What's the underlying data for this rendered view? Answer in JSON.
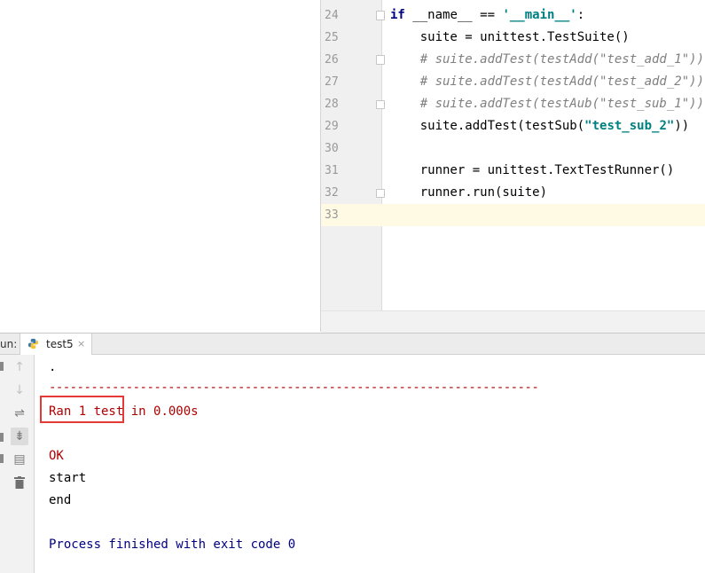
{
  "editor": {
    "lines": [
      {
        "num": "24",
        "segments": [
          {
            "t": "if ",
            "c": "kw"
          },
          {
            "t": "__name__ == ",
            "c": "fn"
          },
          {
            "t": "'__main__'",
            "c": "str"
          },
          {
            "t": ":",
            "c": "fn"
          }
        ]
      },
      {
        "num": "25",
        "segments": [
          {
            "t": "    suite = unittest.TestSuite()",
            "c": "fn"
          }
        ]
      },
      {
        "num": "26",
        "segments": [
          {
            "t": "    # suite.addTest(testAdd(\"test_add_1\"))",
            "c": "cmt"
          }
        ]
      },
      {
        "num": "27",
        "segments": [
          {
            "t": "    # suite.addTest(testAdd(\"test_add_2\"))",
            "c": "cmt"
          }
        ]
      },
      {
        "num": "28",
        "segments": [
          {
            "t": "    # suite.addTest(testAub(\"test_sub_1\"))",
            "c": "cmt"
          }
        ]
      },
      {
        "num": "29",
        "segments": [
          {
            "t": "    suite.addTest(testSub(",
            "c": "fn"
          },
          {
            "t": "\"test_sub_2\"",
            "c": "str"
          },
          {
            "t": "))",
            "c": "fn"
          }
        ]
      },
      {
        "num": "30",
        "segments": []
      },
      {
        "num": "31",
        "segments": [
          {
            "t": "    runner = unittest.TextTestRunner()",
            "c": "fn"
          }
        ]
      },
      {
        "num": "32",
        "segments": [
          {
            "t": "    runner.run(suite)",
            "c": "fn"
          }
        ]
      },
      {
        "num": "33",
        "segments": []
      }
    ],
    "current_line": "33"
  },
  "run": {
    "label": "un:",
    "tab_label": "test5",
    "tab_close": "×"
  },
  "toolbar": {
    "up": "↑",
    "down": "↓",
    "wrap": "⇌",
    "scroll": "⇟",
    "print": "▤",
    "trash": "🗑"
  },
  "console": {
    "dot": ".",
    "separator": "----------------------------------------------------------------------",
    "ran": "Ran 1 test",
    "ran_suffix": " in 0.000s",
    "ok": "OK",
    "start": "start",
    "end": "end",
    "process": "Process finished with exit code 0"
  },
  "colors": {
    "highlight_box": "#e53935",
    "current_line": "#fffae3"
  }
}
